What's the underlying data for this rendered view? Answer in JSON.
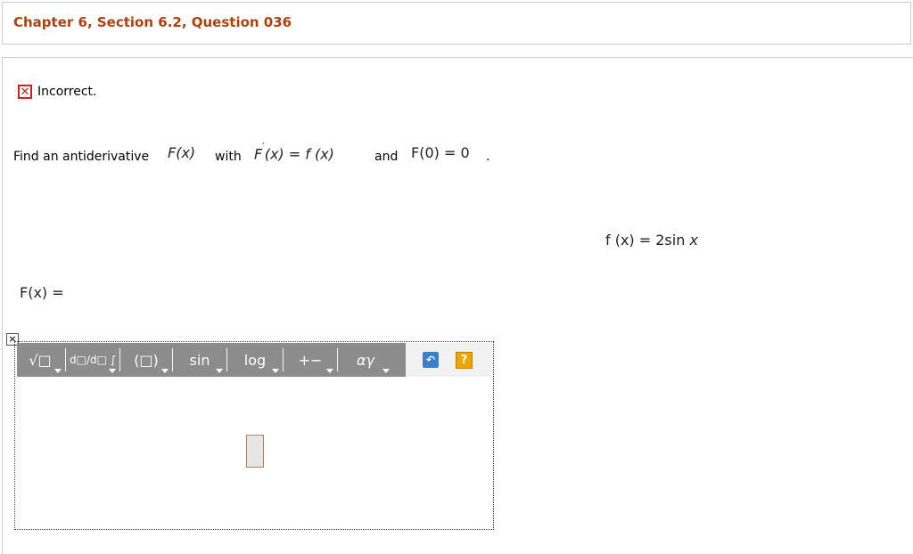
{
  "header": {
    "title": "Chapter 6, Section 6.2, Question 036"
  },
  "status": {
    "icon": "x-mark-icon",
    "text": "Incorrect."
  },
  "question": {
    "prefix": "Find an antiderivative",
    "expr1": "F(x)",
    "with": "with",
    "expr2_F": "F",
    "expr2_prime": "′",
    "expr2_rest": "(x) = f (x)",
    "and": "and",
    "expr3": "F(0) = 0",
    "period": "."
  },
  "given": {
    "lhs": "f (x) = 2sin",
    "var": "x"
  },
  "answer": {
    "label": "F(x) ="
  },
  "editor": {
    "close_label": "×",
    "buttons": {
      "roots": "√□",
      "calculus": "d□/d□ ∫",
      "parens": "(□)",
      "trig": "sin",
      "log": "log",
      "ops": "+−",
      "greek": "αγ",
      "undo": "↶",
      "help": "?"
    }
  },
  "colors": {
    "title": "#b0410f",
    "error": "#cc2222",
    "toolbar": "#8c8c8c",
    "undo": "#3a7fc9",
    "help": "#f0a500"
  }
}
